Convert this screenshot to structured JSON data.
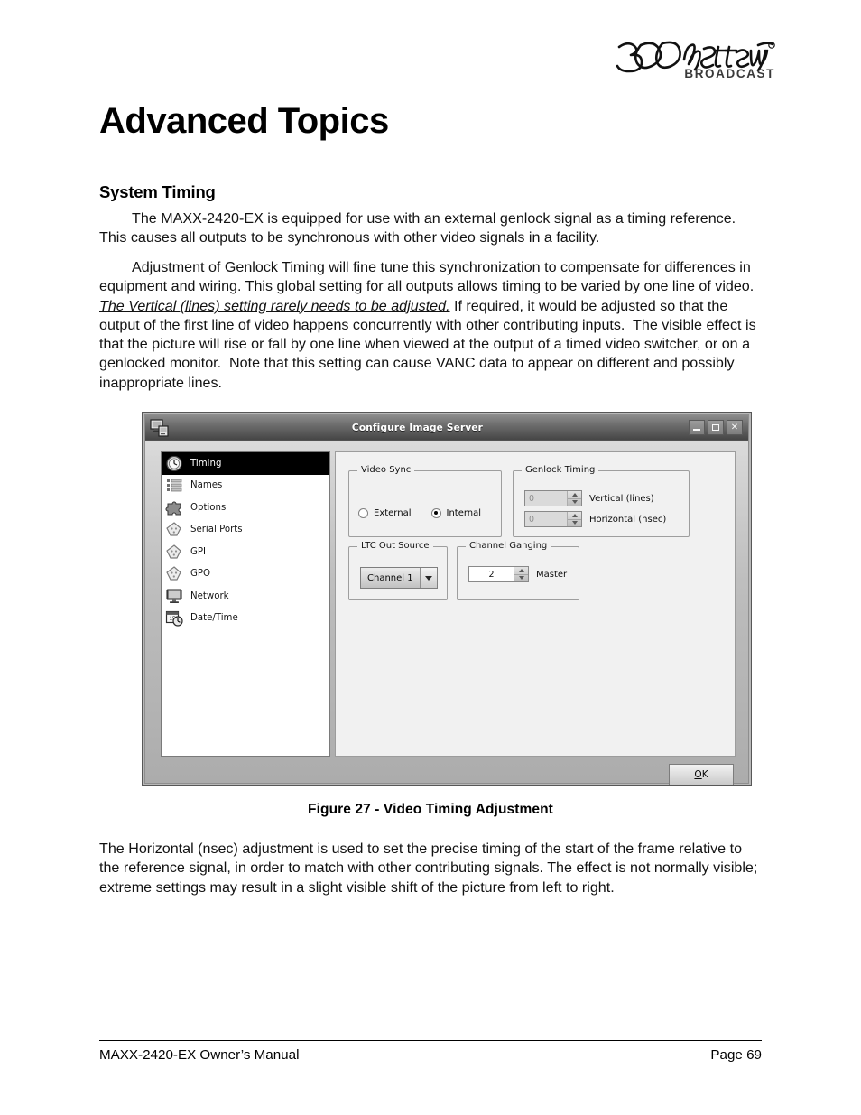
{
  "header": {
    "logo_primary": "360 Systems",
    "logo_secondary": "BROADCAST",
    "logo_registered": "®"
  },
  "page_title": "Advanced Topics",
  "section": {
    "heading": "System Timing",
    "paragraph_1": "The MAXX-2420-EX is equipped for use with an external genlock signal as a timing reference. This causes all outputs to be synchronous with other video signals in a facility.",
    "paragraph_2_a": "Adjustment of Genlock Timing will fine tune this synchronization to compensate for differences in equipment and wiring. This global setting for all outputs allows timing to be varied by one line of video.  ",
    "paragraph_2_emph": "The Vertical (lines) setting rarely needs to be adjusted.",
    "paragraph_2_b": " If required, it would be adjusted so that the output of the first line of video happens concurrently with other contributing inputs.  The visible effect is that the picture will rise or fall by one line when viewed at the output of a timed video switcher, or on a genlocked monitor.  Note that this setting can cause VANC data to appear on different and possibly inappropriate lines.",
    "paragraph_3": "The Horizontal (nsec) adjustment is used to set the precise timing of the start of the frame relative to the reference signal, in order to match with other contributing signals. The effect is not normally visible; extreme settings may result in a slight visible shift of the picture from left to right."
  },
  "figure": {
    "caption": "Figure 27 - Video Timing Adjustment"
  },
  "dialog": {
    "title": "Configure Image Server",
    "titlebar_icon": "server-monitor-icon",
    "window_buttons": {
      "minimize": "–",
      "maximize": "□",
      "close": "✕"
    },
    "sidebar": {
      "items": [
        {
          "label": "Timing",
          "icon": "clock-icon",
          "selected": true
        },
        {
          "label": "Names",
          "icon": "list-icon",
          "selected": false
        },
        {
          "label": "Options",
          "icon": "puzzle-piece-icon",
          "selected": false
        },
        {
          "label": "Serial Ports",
          "icon": "connector-icon",
          "selected": false
        },
        {
          "label": "GPI",
          "icon": "connector-icon",
          "selected": false
        },
        {
          "label": "GPO",
          "icon": "connector-icon",
          "selected": false
        },
        {
          "label": "Network",
          "icon": "monitor-icon",
          "selected": false
        },
        {
          "label": "Date/Time",
          "icon": "calendar-clock-icon",
          "selected": false
        }
      ]
    },
    "groups": {
      "video_sync": {
        "title": "Video Sync",
        "options": [
          {
            "label": "External",
            "selected": false
          },
          {
            "label": "Internal",
            "selected": true
          }
        ]
      },
      "genlock_timing": {
        "title": "Genlock Timing",
        "fields": [
          {
            "label": "Vertical (lines)",
            "value": "0",
            "enabled": false
          },
          {
            "label": "Horizontal (nsec)",
            "value": "0",
            "enabled": false
          }
        ]
      },
      "ltc_out_source": {
        "title": "LTC Out Source",
        "selected": "Channel 1"
      },
      "channel_ganging": {
        "title": "Channel Ganging",
        "value": "2",
        "label": "Master"
      }
    },
    "ok_button": {
      "accel": "O",
      "rest": "K"
    }
  },
  "footer": {
    "left": "MAXX-2420-EX Owner’s Manual",
    "right": "Page 69"
  }
}
